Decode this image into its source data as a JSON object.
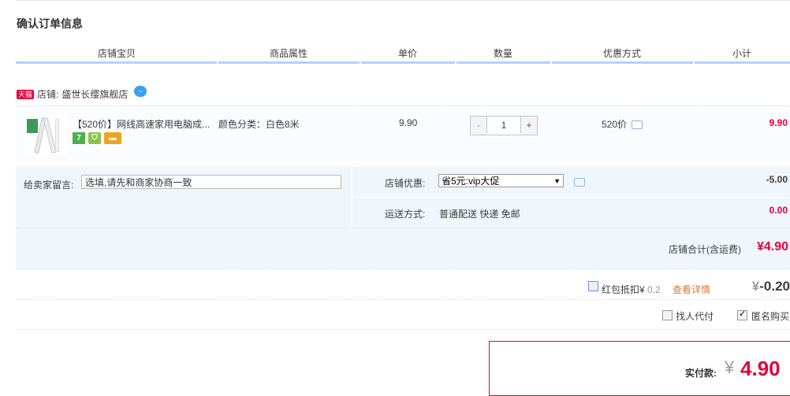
{
  "page": {
    "title": "确认订单信息"
  },
  "table_headers": [
    "店铺宝贝",
    "商品属性",
    "单价",
    "数量",
    "优惠方式",
    "小计"
  ],
  "shop": {
    "badge": "天猫",
    "label": "店铺:",
    "name": "盛世长缨旗舰店",
    "ww_icon": "wangwang-chat-icon"
  },
  "item": {
    "title": "【520价】网线高速家用电脑成...",
    "attribute": "颜色分类：白色8米",
    "unit_price": "9.90",
    "quantity": "1",
    "qty_minus": "-",
    "qty_plus": "+",
    "promotion": "520价",
    "subtotal": "9.90",
    "service_icons": [
      "7",
      "shield-icon",
      "card-icon"
    ]
  },
  "message": {
    "label": "给卖家留言:",
    "value": "选填,请先和商家协商一致"
  },
  "discount": {
    "label": "店铺优惠:",
    "selected": "省5元:vip大促",
    "value": "-5.00"
  },
  "shipping": {
    "label": "运送方式:",
    "value": "普通配送 快递 免邮",
    "fee": "0.00"
  },
  "shop_total": {
    "label": "店铺合计(含运费)",
    "value": "¥4.90"
  },
  "red_packet": {
    "label": "红包抵扣¥",
    "amount": "0.2",
    "link": "查看详情",
    "yen": "¥",
    "value": "-0.20"
  },
  "options": {
    "proxy_pay": "找人代付",
    "anonymous": "匿名购买",
    "anonymous_checked": true,
    "proxy_checked": false
  },
  "payment": {
    "label": "实付款:",
    "yen": "¥",
    "value": "4.90"
  },
  "colors": {
    "accent": "#e4003a",
    "header_line": "#b2d1ff",
    "panel_bg": "#f1f6fc"
  }
}
